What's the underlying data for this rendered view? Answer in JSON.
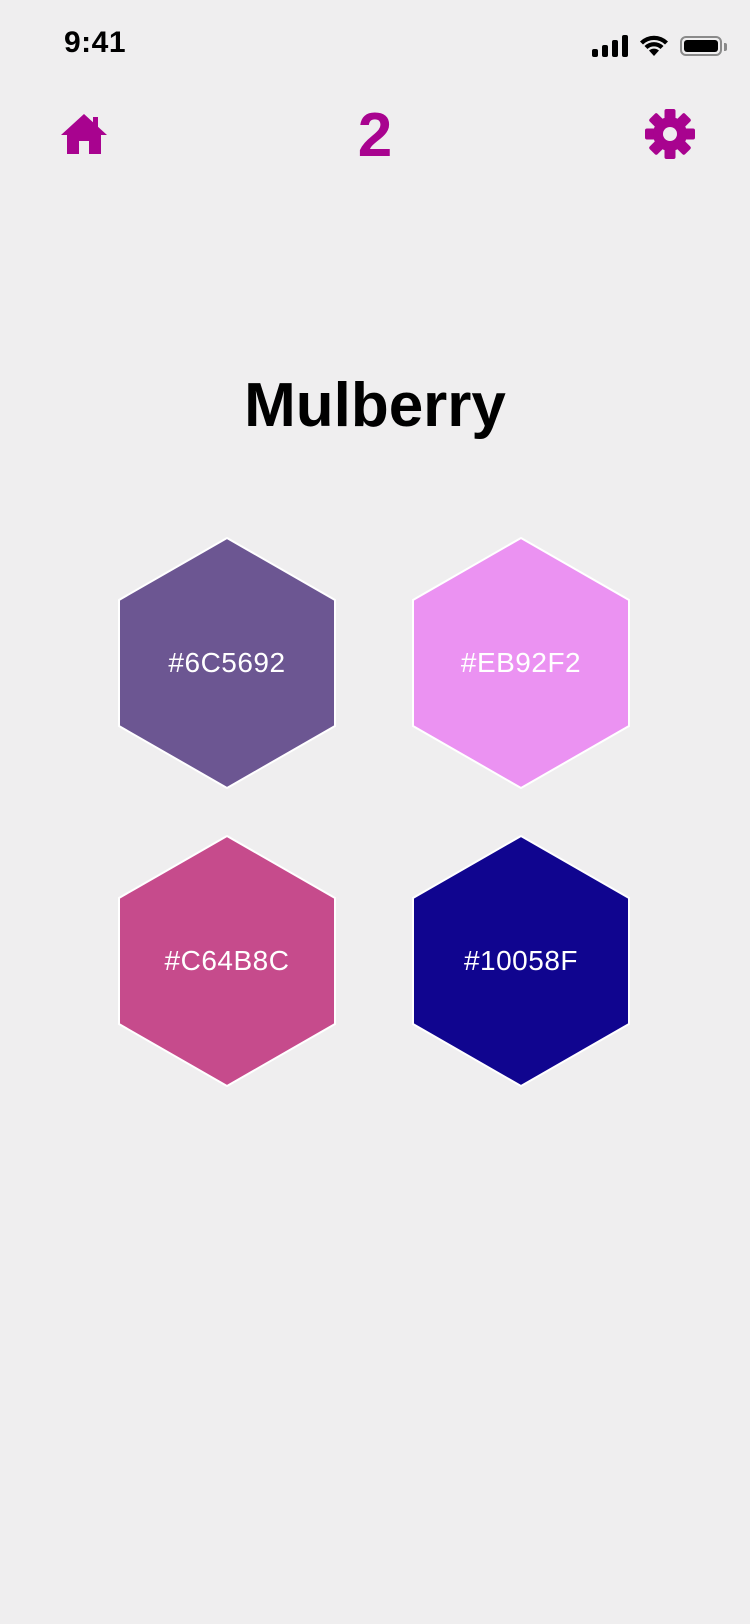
{
  "status_bar": {
    "time": "9:41"
  },
  "header": {
    "level": "2"
  },
  "palette": {
    "name": "Mulberry",
    "swatches": [
      {
        "hex": "#6C5692",
        "color": "#6c5692"
      },
      {
        "hex": "#EB92F2",
        "color": "#eb92f2"
      },
      {
        "hex": "#C64B8C",
        "color": "#c64b8c"
      },
      {
        "hex": "#10058F",
        "color": "#10058f"
      }
    ]
  },
  "colors": {
    "accent": "#a8038f",
    "background": "#efeeef"
  }
}
